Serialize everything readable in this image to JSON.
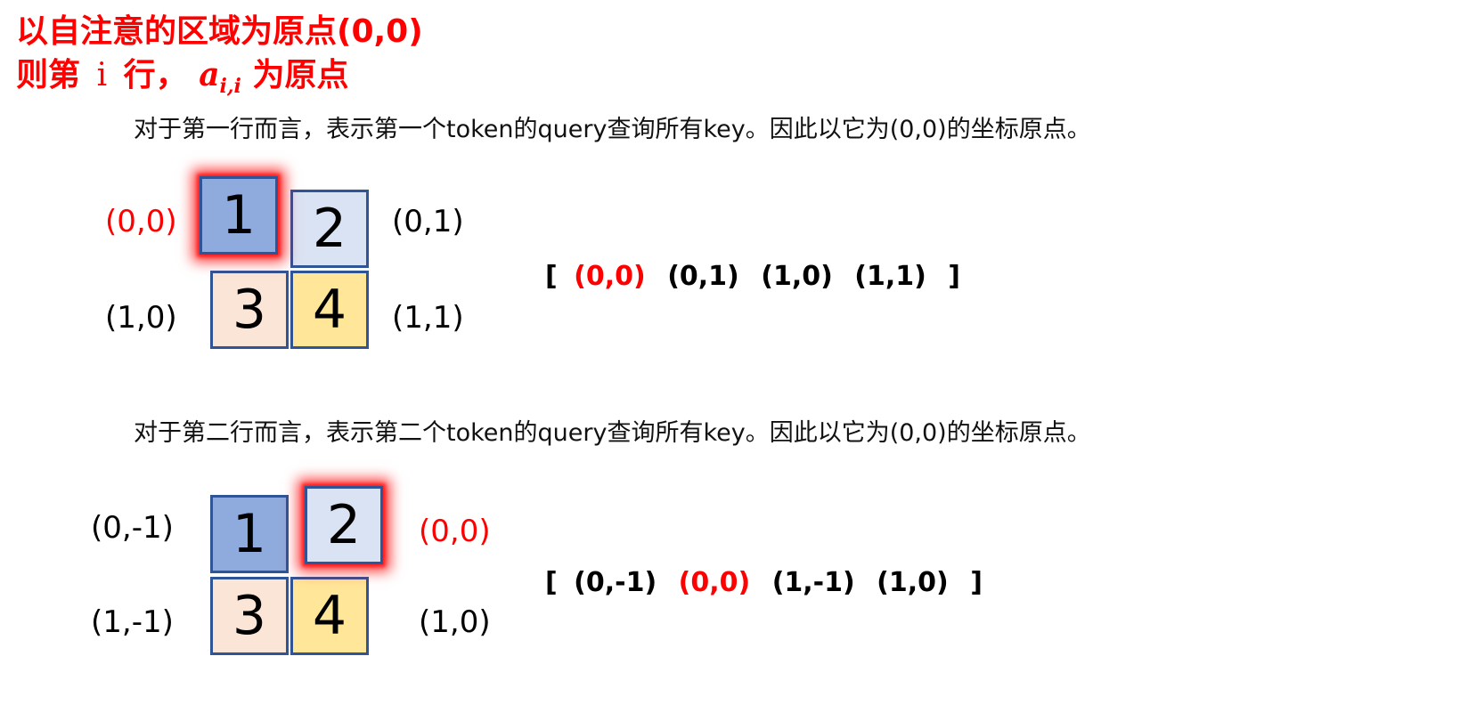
{
  "title": {
    "line1": "以自注意的区域为原点(0,0)",
    "line2_prefix": "则第",
    "line2_i": "i",
    "line2_mid": "行，",
    "math_var": "a",
    "math_sub": "i,i",
    "line2_suffix": "为原点"
  },
  "section1": {
    "text": "对于第一行而言，表示第一个token的query查询所有key。因此以它为(0,0)的坐标原点。",
    "boxes": [
      "1",
      "2",
      "3",
      "4"
    ],
    "labels": {
      "b1": "(0,0)",
      "b2": "(0,1)",
      "b3": "(1,0)",
      "b4": "(1,1)"
    },
    "list_open": "[",
    "list_items": [
      "(0,0)",
      "(0,1)",
      "(1,0)",
      "(1,1)"
    ],
    "list_close": "]",
    "highlight_index": 0
  },
  "section2": {
    "text": "对于第二行而言，表示第二个token的query查询所有key。因此以它为(0,0)的坐标原点。",
    "boxes": [
      "1",
      "2",
      "3",
      "4"
    ],
    "labels": {
      "b1": "(0,-1)",
      "b2": "(0,0)",
      "b3": "(1,-1)",
      "b4": "(1,0)"
    },
    "list_open": "[",
    "list_items": [
      "(0,-1)",
      "(0,0)",
      "(1,-1)",
      "(1,0)"
    ],
    "list_close": "]",
    "highlight_index": 1
  },
  "colors": {
    "highlight": "#ff0000",
    "box_border": "#2f5597",
    "box1": "#8faadc",
    "box2": "#dae3f3",
    "box3": "#fbe5d6",
    "box4": "#ffe699"
  }
}
